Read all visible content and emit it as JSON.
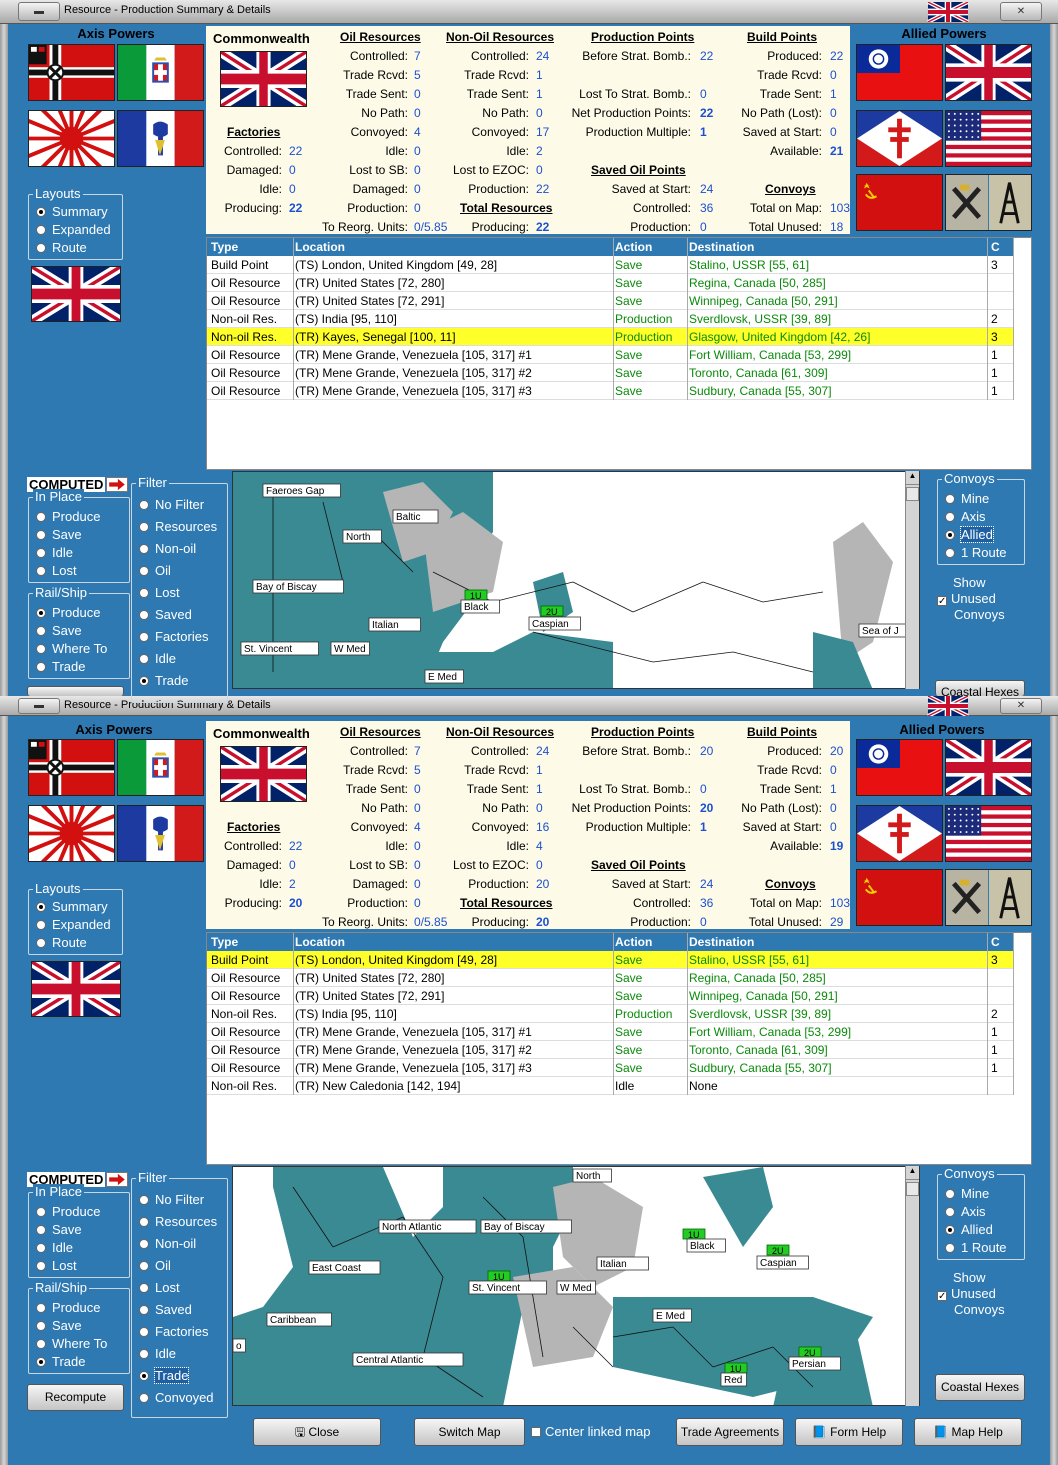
{
  "window_title": "Resource - Production Summary & Details",
  "axis_header": "Axis Powers",
  "allied_header": "Allied Powers",
  "layouts": {
    "legend": "Layouts",
    "options": [
      "Summary",
      "Expanded",
      "Route"
    ],
    "selected": "Summary"
  },
  "computed_label": "COMPUTED",
  "in_place": {
    "legend": "In Place",
    "options": [
      "Produce",
      "Save",
      "Idle",
      "Lost"
    ]
  },
  "rail_ship": {
    "legend": "Rail/Ship",
    "options": [
      "Produce",
      "Save",
      "Where To",
      "Trade"
    ],
    "selected": "Trade"
  },
  "filter": {
    "legend": "Filter",
    "options": [
      "No Filter",
      "Resources",
      "Non-oil",
      "Oil",
      "Lost",
      "Saved",
      "Factories",
      "Idle",
      "Trade",
      "Convoyed"
    ],
    "selected": "Trade"
  },
  "convoys": {
    "legend": "Convoys",
    "options": [
      "Mine",
      "Axis",
      "Allied",
      "1 Route"
    ],
    "selected": "Allied"
  },
  "show_unused": {
    "label_1": "Show",
    "label_2": "Unused",
    "label_3": "Convoys",
    "checked": true
  },
  "coastal_hexes": "Coastal Hexes",
  "recompute": "Recompute",
  "bottom_buttons": {
    "close": "Close",
    "switch_map": "Switch Map",
    "center_linked": "Center linked map",
    "trade_agreements": "Trade Agreements",
    "form_help": "Form Help",
    "map_help": "Map Help"
  },
  "columns": {
    "type": "Type",
    "location": "Location",
    "action": "Action",
    "destination": "Destination",
    "c": "C"
  },
  "labels": {
    "commonwealth": "Commonwealth",
    "oil_resources": "Oil Resources",
    "non_oil_resources": "Non-Oil Resources",
    "production_points": "Production Points",
    "build_points": "Build Points",
    "factories": "Factories",
    "saved_oil_points": "Saved Oil Points",
    "total_resources": "Total Resources",
    "convoys": "Convoys",
    "controlled": "Controlled:",
    "trade_rcvd": "Trade Rcvd:",
    "trade_sent": "Trade Sent:",
    "no_path": "No Path:",
    "convoyed": "Convoyed:",
    "idle": "Idle:",
    "lost_to_sb": "Lost to SB:",
    "lost_to_ezoc": "Lost to EZOC:",
    "damaged": "Damaged:",
    "production": "Production:",
    "producing": "Producing:",
    "to_reorg": "To Reorg. Units:",
    "before_strat": "Before Strat. Bomb.:",
    "lost_to_strat": "Lost To Strat. Bomb.:",
    "net_pp": "Net Production Points:",
    "prod_multiple": "Production Multiple:",
    "produced": "Produced:",
    "no_path_lost": "No Path (Lost):",
    "saved_at_start": "Saved at Start:",
    "available": "Available:",
    "total_on_map": "Total on Map:",
    "total_unused": "Total Unused:"
  },
  "top": {
    "oil": {
      "controlled": "7",
      "trade_rcvd": "5",
      "trade_sent": "0",
      "no_path": "0",
      "convoyed": "4",
      "idle": "0",
      "lost_sb": "0",
      "damaged": "0",
      "production": "0"
    },
    "nonoil": {
      "controlled": "24",
      "trade_rcvd": "1",
      "trade_sent": "1",
      "no_path": "0",
      "convoyed": "17",
      "idle": "2",
      "lost_ezoc": "0",
      "production": "22"
    },
    "factories": {
      "controlled": "22",
      "damaged": "0",
      "idle": "0",
      "producing": "22"
    },
    "to_reorg": "0/5.85",
    "pp": {
      "before": "22",
      "lost": "0",
      "net": "22",
      "multiple": "1"
    },
    "build": {
      "produced": "22",
      "trade_rcvd": "0",
      "trade_sent": "1",
      "no_path": "0",
      "saved": "0",
      "available": "21"
    },
    "saved_oil": {
      "saved": "24",
      "controlled": "36",
      "production": "0"
    },
    "total_resources": {
      "producing": "22"
    },
    "convoys": {
      "total_on_map": "103",
      "total_unused": "18"
    },
    "rows": [
      {
        "type": "Build Point",
        "location": "(TS) London, United Kingdom [49, 28]",
        "action": "Save",
        "destination": "Stalino, USSR [55, 61]",
        "c": "3"
      },
      {
        "type": "Oil Resource",
        "location": "(TR) United States [72, 280]",
        "action": "Save",
        "destination": "Regina, Canada [50, 285]",
        "c": ""
      },
      {
        "type": "Oil Resource",
        "location": "(TR) United States [72, 291]",
        "action": "Save",
        "destination": "Winnipeg, Canada [50, 291]",
        "c": ""
      },
      {
        "type": "Non-oil Res.",
        "location": "(TS) India [95, 110]",
        "action": "Production",
        "destination": "Sverdlovsk, USSR [39, 89]",
        "c": "2"
      },
      {
        "type": "Non-oil Res.",
        "location": "(TR) Kayes, Senegal [100, 11]",
        "action": "Production",
        "destination": "Glasgow, United Kingdom [42, 26]",
        "c": "3",
        "hl": true
      },
      {
        "type": "Oil Resource",
        "location": "(TR) Mene Grande, Venezuela [105, 317] #1",
        "action": "Save",
        "destination": "Fort William, Canada [53, 299]",
        "c": "1"
      },
      {
        "type": "Oil Resource",
        "location": "(TR) Mene Grande, Venezuela [105, 317] #2",
        "action": "Save",
        "destination": "Toronto, Canada [61, 309]",
        "c": "1"
      },
      {
        "type": "Oil Resource",
        "location": "(TR) Mene Grande, Venezuela [105, 317] #3",
        "action": "Save",
        "destination": "Sudbury, Canada [55, 307]",
        "c": "1"
      }
    ],
    "map_labels": [
      "Faeroes Gap",
      "Baltic",
      "North",
      "Bay of Biscay",
      "Black",
      "Caspian",
      "Italian",
      "St. Vincent",
      "W Med",
      "E Med",
      "Sea of J"
    ],
    "map_counters": [
      "1U",
      "2U"
    ]
  },
  "bottom": {
    "oil": {
      "controlled": "7",
      "trade_rcvd": "5",
      "trade_sent": "0",
      "no_path": "0",
      "convoyed": "4",
      "idle": "0",
      "lost_sb": "0",
      "damaged": "0",
      "production": "0"
    },
    "nonoil": {
      "controlled": "24",
      "trade_rcvd": "1",
      "trade_sent": "1",
      "no_path": "0",
      "convoyed": "16",
      "idle": "4",
      "lost_ezoc": "0",
      "production": "20"
    },
    "factories": {
      "controlled": "22",
      "damaged": "0",
      "idle": "2",
      "producing": "20"
    },
    "to_reorg": "0/5.85",
    "pp": {
      "before": "20",
      "lost": "0",
      "net": "20",
      "multiple": "1"
    },
    "build": {
      "produced": "20",
      "trade_rcvd": "0",
      "trade_sent": "1",
      "no_path": "0",
      "saved": "0",
      "available": "19"
    },
    "saved_oil": {
      "saved": "24",
      "controlled": "36",
      "production": "0"
    },
    "total_resources": {
      "producing": "20"
    },
    "convoys": {
      "total_on_map": "103",
      "total_unused": "29"
    },
    "rows": [
      {
        "type": "Build Point",
        "location": "(TS) London, United Kingdom [49, 28]",
        "action": "Save",
        "destination": "Stalino, USSR [55, 61]",
        "c": "3",
        "hl": true
      },
      {
        "type": "Oil Resource",
        "location": "(TR) United States [72, 280]",
        "action": "Save",
        "destination": "Regina, Canada [50, 285]",
        "c": ""
      },
      {
        "type": "Oil Resource",
        "location": "(TR) United States [72, 291]",
        "action": "Save",
        "destination": "Winnipeg, Canada [50, 291]",
        "c": ""
      },
      {
        "type": "Non-oil Res.",
        "location": "(TS) India [95, 110]",
        "action": "Production",
        "destination": "Sverdlovsk, USSR [39, 89]",
        "c": "2"
      },
      {
        "type": "Oil Resource",
        "location": "(TR) Mene Grande, Venezuela [105, 317] #1",
        "action": "Save",
        "destination": "Fort William, Canada [53, 299]",
        "c": "1"
      },
      {
        "type": "Oil Resource",
        "location": "(TR) Mene Grande, Venezuela [105, 317] #2",
        "action": "Save",
        "destination": "Toronto, Canada [61, 309]",
        "c": "1"
      },
      {
        "type": "Oil Resource",
        "location": "(TR) Mene Grande, Venezuela [105, 317] #3",
        "action": "Save",
        "destination": "Sudbury, Canada [55, 307]",
        "c": "1"
      },
      {
        "type": "Non-oil Res.",
        "location": "(TR) New Caledonia [142, 194]",
        "action": "Idle",
        "destination": "None",
        "c": "",
        "plain": true
      }
    ],
    "map_labels": [
      "North",
      "North Atlantic",
      "Bay of Biscay",
      "East Coast",
      "St. Vincent",
      "W Med",
      "Italian",
      "Black",
      "Caspian",
      "Caribbean",
      "E Med",
      "Central Atlantic",
      "Red",
      "Persian",
      "o"
    ],
    "map_counters": [
      "1U",
      "2U"
    ]
  }
}
